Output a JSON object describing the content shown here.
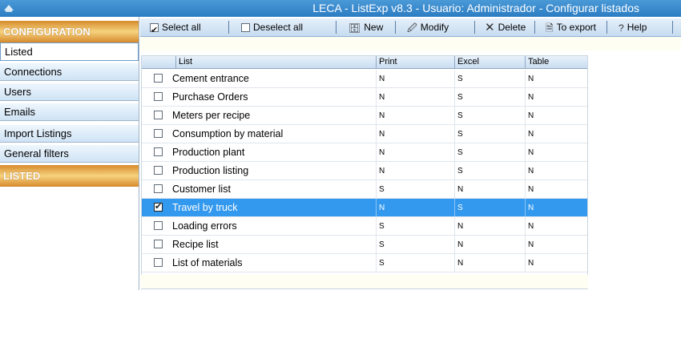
{
  "window": {
    "title": "LECA - ListExp v8.3 - Usuario: Administrador - Configurar listados"
  },
  "sidebar": {
    "configuration_header": "CONFIGURATION",
    "items": [
      {
        "label": "Listed",
        "selected": true
      },
      {
        "label": "Connections"
      },
      {
        "label": "Users"
      },
      {
        "label": "Emails"
      },
      {
        "label": "Import Listings"
      },
      {
        "label": "General filters"
      }
    ],
    "listed_header": "LISTED"
  },
  "toolbar": {
    "select_all": "Select all",
    "deselect_all": "Deselect all",
    "new": "New",
    "modify": "Modify",
    "delete": "Delete",
    "to_export": "To export",
    "help": "Help"
  },
  "grid": {
    "columns": [
      "List",
      "Print",
      "Excel",
      "Table"
    ],
    "rows": [
      {
        "name": "Cement entrance",
        "print": "N",
        "excel": "S",
        "table": "N",
        "checked": false,
        "selected": false
      },
      {
        "name": "Purchase Orders",
        "print": "N",
        "excel": "S",
        "table": "N",
        "checked": false,
        "selected": false
      },
      {
        "name": "Meters per recipe",
        "print": "N",
        "excel": "S",
        "table": "N",
        "checked": false,
        "selected": false
      },
      {
        "name": "Consumption by material",
        "print": "N",
        "excel": "S",
        "table": "N",
        "checked": false,
        "selected": false
      },
      {
        "name": "Production plant",
        "print": "N",
        "excel": "S",
        "table": "N",
        "checked": false,
        "selected": false
      },
      {
        "name": "Production listing",
        "print": "N",
        "excel": "S",
        "table": "N",
        "checked": false,
        "selected": false
      },
      {
        "name": "Customer list",
        "print": "S",
        "excel": "N",
        "table": "N",
        "checked": false,
        "selected": false
      },
      {
        "name": "Travel by truck",
        "print": "N",
        "excel": "S",
        "table": "N",
        "checked": true,
        "selected": true
      },
      {
        "name": "Loading errors",
        "print": "S",
        "excel": "N",
        "table": "N",
        "checked": false,
        "selected": false
      },
      {
        "name": "Recipe list",
        "print": "S",
        "excel": "N",
        "table": "N",
        "checked": false,
        "selected": false
      },
      {
        "name": "List of materials",
        "print": "S",
        "excel": "N",
        "table": "N",
        "checked": false,
        "selected": false
      }
    ]
  },
  "colors": {
    "selection": "#3399ee",
    "section_header": "#e9a94a",
    "titlebar": "#2c7cc2"
  }
}
